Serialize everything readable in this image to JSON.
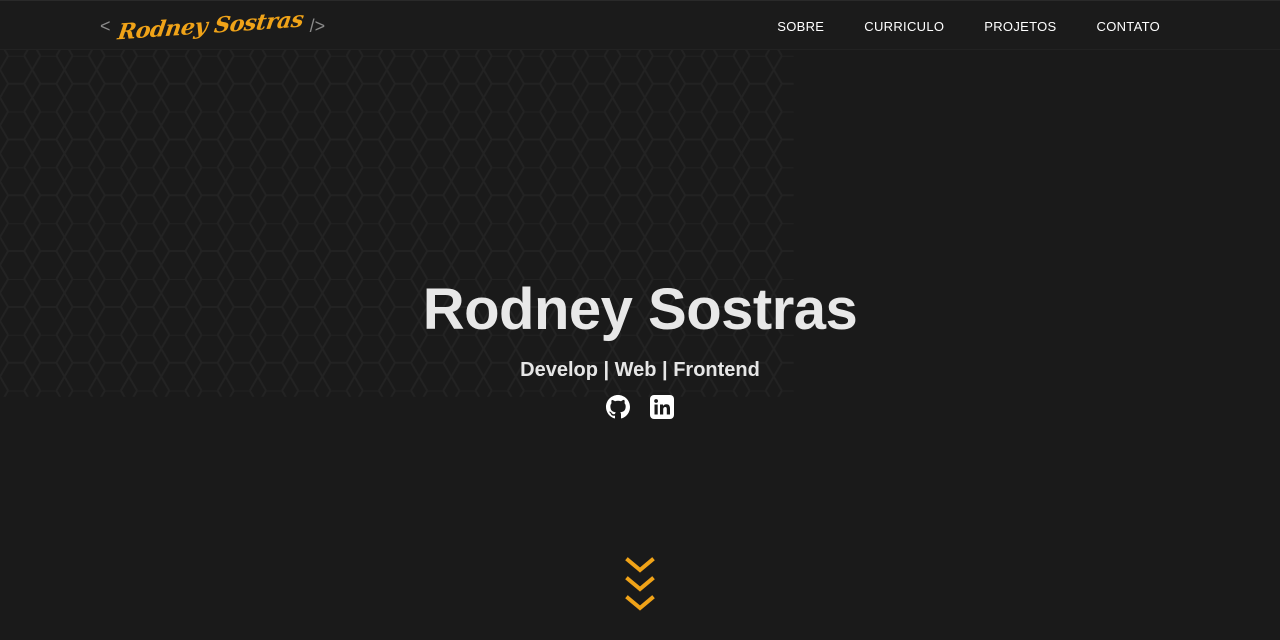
{
  "logo": {
    "open_bracket": "<",
    "name": "Rodney Sostras",
    "close_bracket": "/>",
    "color": "#f0a318"
  },
  "nav": {
    "items": [
      {
        "label": "SOBRE"
      },
      {
        "label": "CURRICULO"
      },
      {
        "label": "PROJETOS"
      },
      {
        "label": "CONTATO"
      }
    ]
  },
  "hero": {
    "title": "Rodney Sostras",
    "subtitle": "Develop | Web | Frontend"
  },
  "socials": [
    {
      "icon": "github-icon"
    },
    {
      "icon": "linkedin-icon"
    }
  ],
  "scroll_indicator": {
    "icon": "chevrons-down-icon",
    "color": "#f0a318"
  },
  "colors": {
    "background": "#1a1a1a",
    "accent": "#f0a318",
    "text": "#e8e8e8"
  }
}
